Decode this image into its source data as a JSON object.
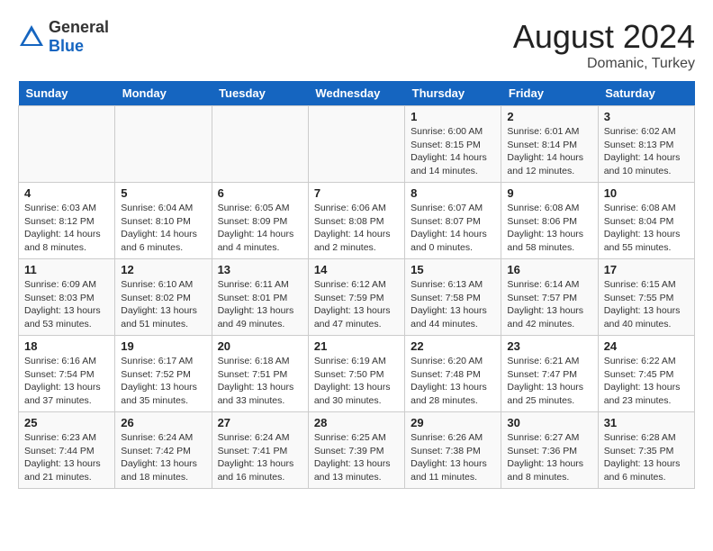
{
  "header": {
    "logo_general": "General",
    "logo_blue": "Blue",
    "month_year": "August 2024",
    "location": "Domanic, Turkey"
  },
  "weekdays": [
    "Sunday",
    "Monday",
    "Tuesday",
    "Wednesday",
    "Thursday",
    "Friday",
    "Saturday"
  ],
  "weeks": [
    [
      {
        "day": "",
        "info": ""
      },
      {
        "day": "",
        "info": ""
      },
      {
        "day": "",
        "info": ""
      },
      {
        "day": "",
        "info": ""
      },
      {
        "day": "1",
        "info": "Sunrise: 6:00 AM\nSunset: 8:15 PM\nDaylight: 14 hours\nand 14 minutes."
      },
      {
        "day": "2",
        "info": "Sunrise: 6:01 AM\nSunset: 8:14 PM\nDaylight: 14 hours\nand 12 minutes."
      },
      {
        "day": "3",
        "info": "Sunrise: 6:02 AM\nSunset: 8:13 PM\nDaylight: 14 hours\nand 10 minutes."
      }
    ],
    [
      {
        "day": "4",
        "info": "Sunrise: 6:03 AM\nSunset: 8:12 PM\nDaylight: 14 hours\nand 8 minutes."
      },
      {
        "day": "5",
        "info": "Sunrise: 6:04 AM\nSunset: 8:10 PM\nDaylight: 14 hours\nand 6 minutes."
      },
      {
        "day": "6",
        "info": "Sunrise: 6:05 AM\nSunset: 8:09 PM\nDaylight: 14 hours\nand 4 minutes."
      },
      {
        "day": "7",
        "info": "Sunrise: 6:06 AM\nSunset: 8:08 PM\nDaylight: 14 hours\nand 2 minutes."
      },
      {
        "day": "8",
        "info": "Sunrise: 6:07 AM\nSunset: 8:07 PM\nDaylight: 14 hours\nand 0 minutes."
      },
      {
        "day": "9",
        "info": "Sunrise: 6:08 AM\nSunset: 8:06 PM\nDaylight: 13 hours\nand 58 minutes."
      },
      {
        "day": "10",
        "info": "Sunrise: 6:08 AM\nSunset: 8:04 PM\nDaylight: 13 hours\nand 55 minutes."
      }
    ],
    [
      {
        "day": "11",
        "info": "Sunrise: 6:09 AM\nSunset: 8:03 PM\nDaylight: 13 hours\nand 53 minutes."
      },
      {
        "day": "12",
        "info": "Sunrise: 6:10 AM\nSunset: 8:02 PM\nDaylight: 13 hours\nand 51 minutes."
      },
      {
        "day": "13",
        "info": "Sunrise: 6:11 AM\nSunset: 8:01 PM\nDaylight: 13 hours\nand 49 minutes."
      },
      {
        "day": "14",
        "info": "Sunrise: 6:12 AM\nSunset: 7:59 PM\nDaylight: 13 hours\nand 47 minutes."
      },
      {
        "day": "15",
        "info": "Sunrise: 6:13 AM\nSunset: 7:58 PM\nDaylight: 13 hours\nand 44 minutes."
      },
      {
        "day": "16",
        "info": "Sunrise: 6:14 AM\nSunset: 7:57 PM\nDaylight: 13 hours\nand 42 minutes."
      },
      {
        "day": "17",
        "info": "Sunrise: 6:15 AM\nSunset: 7:55 PM\nDaylight: 13 hours\nand 40 minutes."
      }
    ],
    [
      {
        "day": "18",
        "info": "Sunrise: 6:16 AM\nSunset: 7:54 PM\nDaylight: 13 hours\nand 37 minutes."
      },
      {
        "day": "19",
        "info": "Sunrise: 6:17 AM\nSunset: 7:52 PM\nDaylight: 13 hours\nand 35 minutes."
      },
      {
        "day": "20",
        "info": "Sunrise: 6:18 AM\nSunset: 7:51 PM\nDaylight: 13 hours\nand 33 minutes."
      },
      {
        "day": "21",
        "info": "Sunrise: 6:19 AM\nSunset: 7:50 PM\nDaylight: 13 hours\nand 30 minutes."
      },
      {
        "day": "22",
        "info": "Sunrise: 6:20 AM\nSunset: 7:48 PM\nDaylight: 13 hours\nand 28 minutes."
      },
      {
        "day": "23",
        "info": "Sunrise: 6:21 AM\nSunset: 7:47 PM\nDaylight: 13 hours\nand 25 minutes."
      },
      {
        "day": "24",
        "info": "Sunrise: 6:22 AM\nSunset: 7:45 PM\nDaylight: 13 hours\nand 23 minutes."
      }
    ],
    [
      {
        "day": "25",
        "info": "Sunrise: 6:23 AM\nSunset: 7:44 PM\nDaylight: 13 hours\nand 21 minutes."
      },
      {
        "day": "26",
        "info": "Sunrise: 6:24 AM\nSunset: 7:42 PM\nDaylight: 13 hours\nand 18 minutes."
      },
      {
        "day": "27",
        "info": "Sunrise: 6:24 AM\nSunset: 7:41 PM\nDaylight: 13 hours\nand 16 minutes."
      },
      {
        "day": "28",
        "info": "Sunrise: 6:25 AM\nSunset: 7:39 PM\nDaylight: 13 hours\nand 13 minutes."
      },
      {
        "day": "29",
        "info": "Sunrise: 6:26 AM\nSunset: 7:38 PM\nDaylight: 13 hours\nand 11 minutes."
      },
      {
        "day": "30",
        "info": "Sunrise: 6:27 AM\nSunset: 7:36 PM\nDaylight: 13 hours\nand 8 minutes."
      },
      {
        "day": "31",
        "info": "Sunrise: 6:28 AM\nSunset: 7:35 PM\nDaylight: 13 hours\nand 6 minutes."
      }
    ]
  ]
}
